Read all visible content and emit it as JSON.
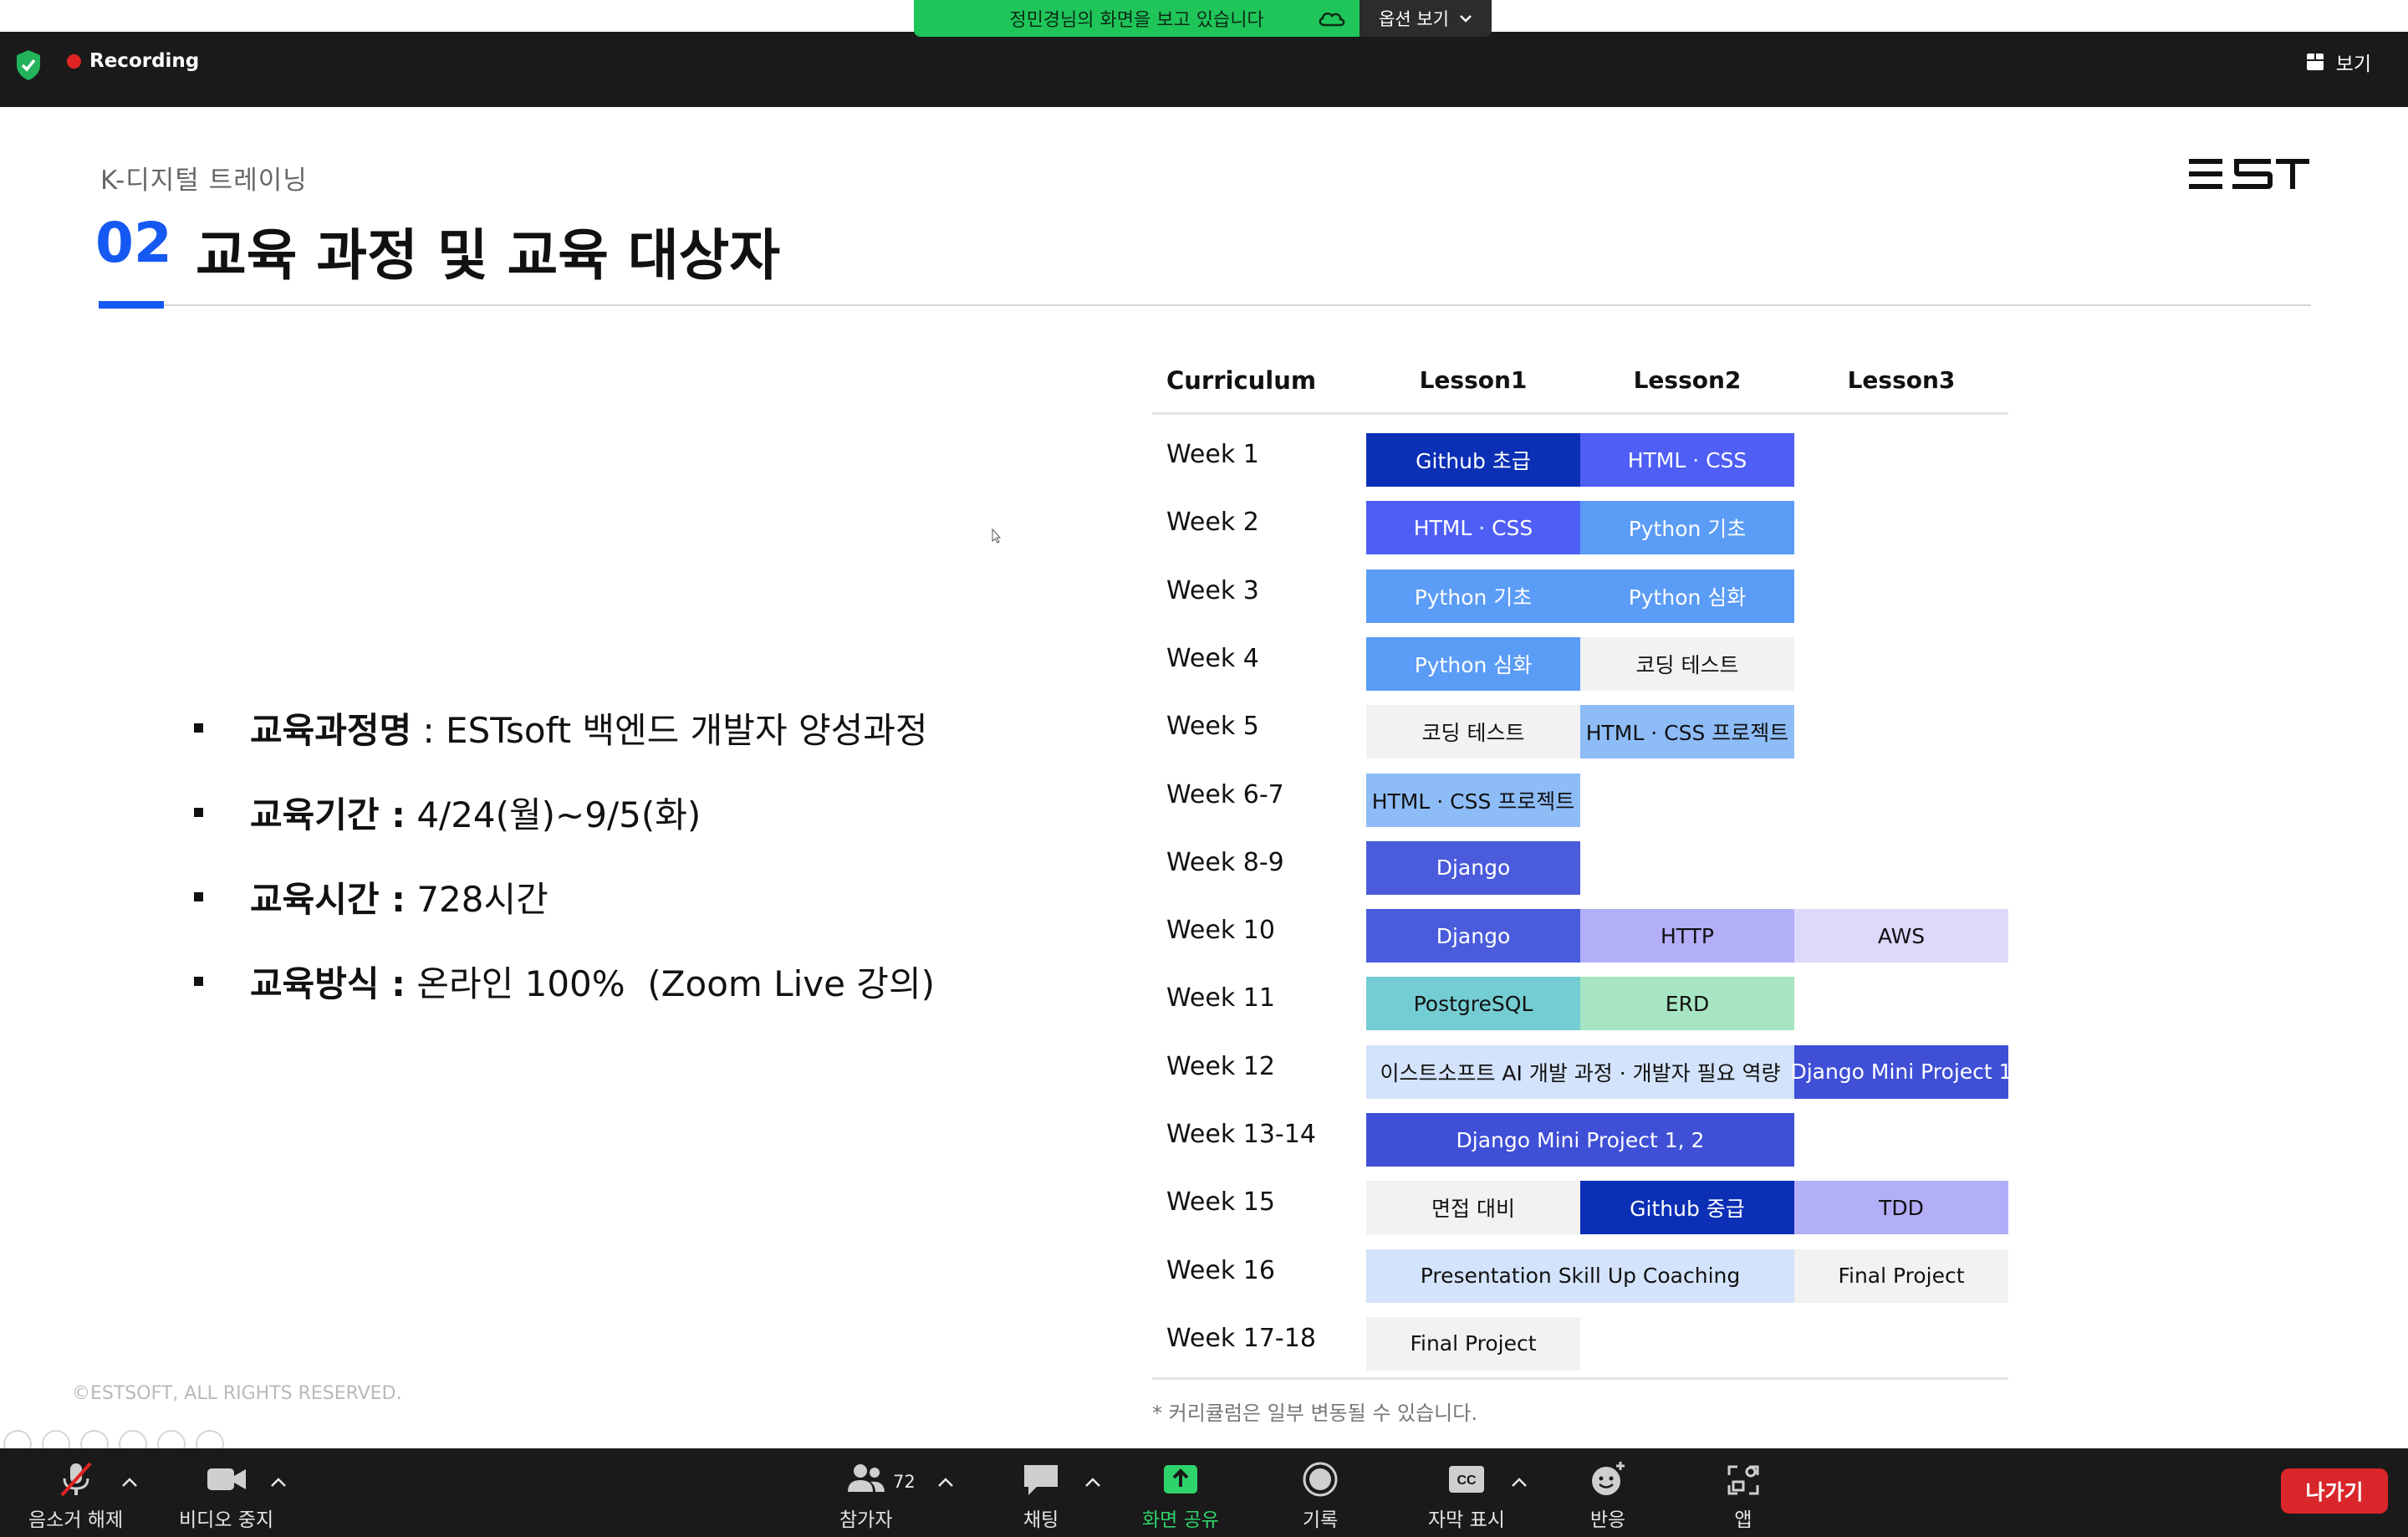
{
  "topbar": {
    "recording_label": "Recording",
    "share_banner": "정민경님의 화면을 보고 있습니다",
    "options_label": "옵션 보기",
    "view_label": "보기"
  },
  "slide": {
    "subtitle": "K-디지털 트레이닝",
    "section_number": "02",
    "section_title": "교육 과정 및 교육 대상자",
    "logo_text": "EST",
    "bullets": [
      {
        "key": "교육과정명",
        "value": " : ESTsoft 백엔드 개발자 양성과정"
      },
      {
        "key": "교육기간 :",
        "value": " 4/24(월)~9/5(화)"
      },
      {
        "key": "교육시간 :",
        "value": " 728시간"
      },
      {
        "key": "교육방식 :",
        "value": " 온라인 100%  (Zoom Live 강의)"
      }
    ],
    "copyright": "©ESTSOFT, ALL RIGHTS RESERVED.",
    "curriculum": {
      "headers": [
        "Curriculum",
        "Lesson1",
        "Lesson2",
        "Lesson3"
      ],
      "note": "* 커리큘럼은 일부 변동될 수 있습니다.",
      "rows": [
        {
          "week": "Week 1",
          "cells": [
            {
              "text": "Github 초급",
              "col": 1,
              "span": 1,
              "bg": "#0b2fb5",
              "fg": "#ffffff"
            },
            {
              "text": "HTML · CSS",
              "col": 2,
              "span": 1,
              "bg": "#4f5ef5",
              "fg": "#ffffff"
            }
          ]
        },
        {
          "week": "Week 2",
          "cells": [
            {
              "text": "HTML · CSS",
              "col": 1,
              "span": 1,
              "bg": "#4f5ef5",
              "fg": "#ffffff"
            },
            {
              "text": "Python 기초",
              "col": 2,
              "span": 1,
              "bg": "#5b9cf6",
              "fg": "#ffffff"
            }
          ]
        },
        {
          "week": "Week 3",
          "cells": [
            {
              "text": "Python 기초",
              "col": 1,
              "span": 1,
              "bg": "#5b9cf6",
              "fg": "#ffffff"
            },
            {
              "text": "Python 심화",
              "col": 2,
              "span": 1,
              "bg": "#5b9cf6",
              "fg": "#ffffff"
            }
          ]
        },
        {
          "week": "Week 4",
          "cells": [
            {
              "text": "Python 심화",
              "col": 1,
              "span": 1,
              "bg": "#5b9cf6",
              "fg": "#ffffff"
            },
            {
              "text": "코딩 테스트",
              "col": 2,
              "span": 1,
              "bg": "#f2f2f2",
              "fg": "#111111"
            }
          ]
        },
        {
          "week": "Week 5",
          "cells": [
            {
              "text": "코딩 테스트",
              "col": 1,
              "span": 1,
              "bg": "#f2f2f2",
              "fg": "#111111"
            },
            {
              "text": "HTML · CSS 프로젝트",
              "col": 2,
              "span": 1,
              "bg": "#8dbcf7",
              "fg": "#111111"
            }
          ]
        },
        {
          "week": "Week 6-7",
          "cells": [
            {
              "text": "HTML · CSS 프로젝트",
              "col": 1,
              "span": 1,
              "bg": "#8dbcf7",
              "fg": "#111111"
            }
          ]
        },
        {
          "week": "Week 8-9",
          "cells": [
            {
              "text": "Django",
              "col": 1,
              "span": 1,
              "bg": "#4a5bdb",
              "fg": "#ffffff"
            }
          ]
        },
        {
          "week": "Week 10",
          "cells": [
            {
              "text": "Django",
              "col": 1,
              "span": 1,
              "bg": "#4a5bdb",
              "fg": "#ffffff"
            },
            {
              "text": "HTTP",
              "col": 2,
              "span": 1,
              "bg": "#b3aef8",
              "fg": "#111111"
            },
            {
              "text": "AWS",
              "col": 3,
              "span": 1,
              "bg": "#dcd9fb",
              "fg": "#111111"
            }
          ]
        },
        {
          "week": "Week 11",
          "cells": [
            {
              "text": "PostgreSQL",
              "col": 1,
              "span": 1,
              "bg": "#74cdd3",
              "fg": "#111111"
            },
            {
              "text": "ERD",
              "col": 2,
              "span": 1,
              "bg": "#a7e4c2",
              "fg": "#111111"
            }
          ]
        },
        {
          "week": "Week 12",
          "cells": [
            {
              "text": "이스트소프트 AI 개발 과정 · 개발자 필요 역량",
              "col": 1,
              "span": 2,
              "bg": "#d3e3fb",
              "fg": "#111111"
            },
            {
              "text": "Django Mini Project 1",
              "col": 3,
              "span": 1,
              "bg": "#3f4fd6",
              "fg": "#ffffff"
            }
          ]
        },
        {
          "week": "Week 13-14",
          "cells": [
            {
              "text": "Django Mini Project 1, 2",
              "col": 1,
              "span": 2,
              "bg": "#3f4fd6",
              "fg": "#ffffff"
            }
          ]
        },
        {
          "week": "Week 15",
          "cells": [
            {
              "text": "면접 대비",
              "col": 1,
              "span": 1,
              "bg": "#f2f2f2",
              "fg": "#111111"
            },
            {
              "text": "Github 중급",
              "col": 2,
              "span": 1,
              "bg": "#0b2fb5",
              "fg": "#ffffff"
            },
            {
              "text": "TDD",
              "col": 3,
              "span": 1,
              "bg": "#b3aef8",
              "fg": "#111111"
            }
          ]
        },
        {
          "week": "Week 16",
          "cells": [
            {
              "text": "Presentation Skill Up Coaching",
              "col": 1,
              "span": 2,
              "bg": "#d3e3fb",
              "fg": "#111111"
            },
            {
              "text": "Final Project",
              "col": 3,
              "span": 1,
              "bg": "#f2f2f2",
              "fg": "#111111"
            }
          ]
        },
        {
          "week": "Week 17-18",
          "cells": [
            {
              "text": "Final Project",
              "col": 1,
              "span": 1,
              "bg": "#f2f2f2",
              "fg": "#111111"
            }
          ]
        }
      ]
    }
  },
  "toolbar": {
    "mute": "음소거 해제",
    "video": "비디오 중지",
    "participants": "참가자",
    "participants_count": "72",
    "chat": "채팅",
    "share": "화면 공유",
    "record": "기록",
    "captions": "자막 표시",
    "reactions": "반응",
    "apps": "앱",
    "leave": "나가기"
  },
  "colors": {
    "accent": "#1659f2",
    "share_green": "#20c55a",
    "leave_red": "#d9262b",
    "recording_red": "#e02424"
  }
}
